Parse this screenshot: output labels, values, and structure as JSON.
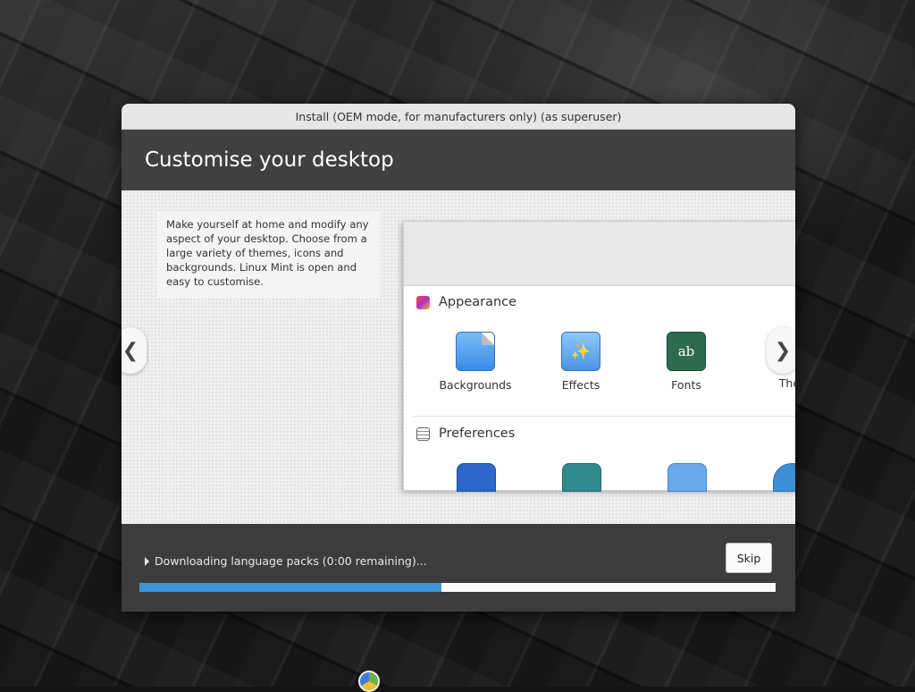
{
  "window": {
    "title": "Install (OEM mode, for manufacturers only) (as superuser)"
  },
  "header": {
    "title": "Customise your desktop"
  },
  "slide": {
    "description": "Make yourself at home and modify any aspect of your desktop. Choose from a large variety of themes, icons and backgrounds. Linux Mint is open and easy to customise.",
    "prev_label": "❮",
    "next_label": "❯",
    "preview": {
      "appearance_label": "Appearance",
      "preferences_label": "Preferences",
      "apps": [
        {
          "label": "Backgrounds",
          "icon": "backgrounds-icon"
        },
        {
          "label": "Effects",
          "icon": "effects-icon"
        },
        {
          "label": "Fonts",
          "icon": "fonts-icon",
          "glyph": "ab"
        },
        {
          "label": "Ther",
          "icon": "themes-icon"
        }
      ],
      "preference_icons": [
        "accessibility-icon",
        "account-details-icon",
        "applets-icon",
        "date-time-icon"
      ]
    }
  },
  "footer": {
    "status": "Downloading language packs (0:00 remaining)...",
    "skip_label": "Skip",
    "progress_fraction": 0.475
  },
  "colors": {
    "accent": "#3d95dc",
    "header_bg": "#404040",
    "fonts_icon": "#2e6b4e"
  }
}
